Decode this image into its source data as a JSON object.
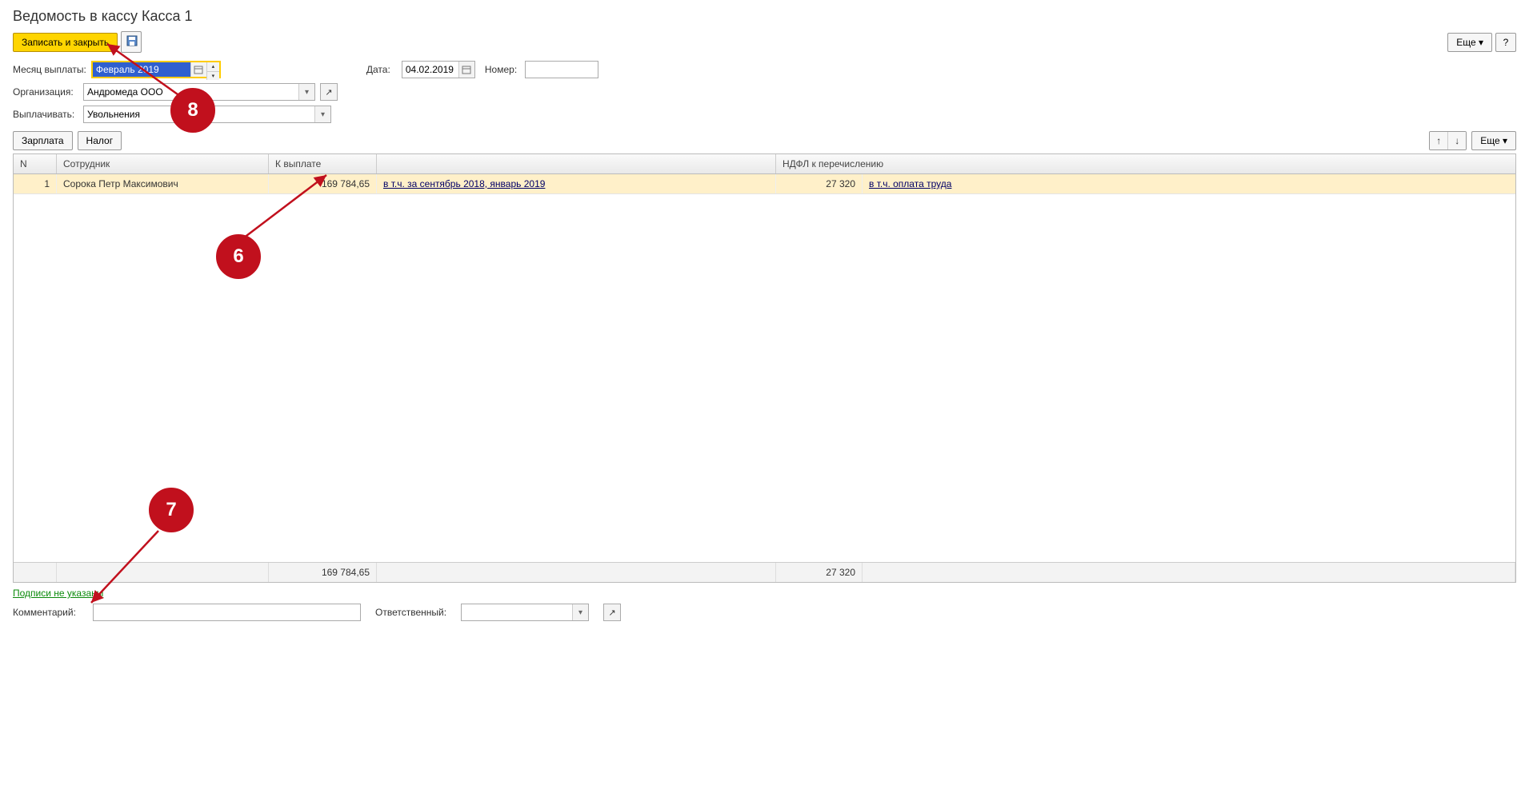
{
  "title": "Ведомость в кассу Касса 1",
  "toolbar": {
    "save_close": "Записать и закрыть",
    "more": "Еще"
  },
  "form": {
    "month_label": "Месяц выплаты:",
    "month_value": "Февраль 2019",
    "date_label": "Дата:",
    "date_value": "04.02.2019",
    "number_label": "Номер:",
    "number_value": "",
    "org_label": "Организация:",
    "org_value": "Андромеда ООО",
    "pay_label": "Выплачивать:",
    "pay_value": "Увольнения"
  },
  "subtoolbar": {
    "salary": "Зарплата",
    "tax": "Налог",
    "more": "Еще"
  },
  "table": {
    "headers": {
      "n": "N",
      "employee": "Сотрудник",
      "to_pay": "К выплате",
      "ndfl": "НДФЛ к перечислению"
    },
    "rows": [
      {
        "n": "1",
        "employee": "Сорока Петр Максимович",
        "to_pay": "169 784,65",
        "pay_detail": "в т.ч. за сентябрь 2018, январь 2019",
        "ndfl": "27 320",
        "ndfl_detail": "в т.ч. оплата труда"
      }
    ],
    "totals": {
      "to_pay": "169 784,65",
      "ndfl": "27 320"
    }
  },
  "signatures": "Подписи не указаны",
  "bottom": {
    "comment_label": "Комментарий:",
    "comment_value": "",
    "resp_label": "Ответственный:",
    "resp_value": ""
  },
  "callouts": {
    "c6": "6",
    "c7": "7",
    "c8": "8"
  }
}
